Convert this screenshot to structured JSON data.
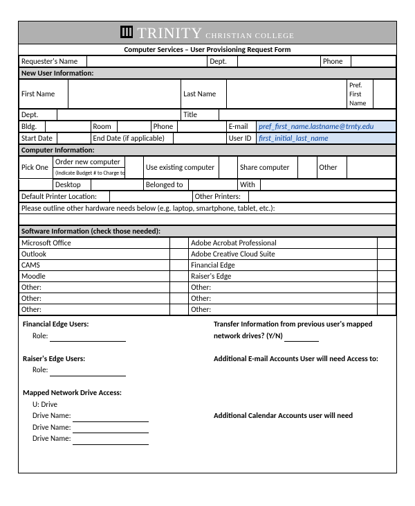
{
  "brand": {
    "main": "TRINITY",
    "sub": "CHRISTIAN COLLEGE"
  },
  "form_title": "Computer Services – User Provisioning Request Form",
  "requester": {
    "name_label": "Requester's Name",
    "dept_label": "Dept.",
    "phone_label": "Phone"
  },
  "sections": {
    "new_user": "New User Information:",
    "computer": "Computer Information:",
    "software": "Software Information (check those needed):"
  },
  "new_user": {
    "first_name": "First Name",
    "last_name": "Last Name",
    "pref_first": "Pref. First Name",
    "dept": "Dept.",
    "title": "Title",
    "bldg": "Bldg.",
    "room": "Room",
    "phone": "Phone",
    "email": "E-mail",
    "email_hint": "pref_first_name.lastname@trnty.edu",
    "start_date": "Start Date",
    "end_date": "End Date (if applicable)",
    "user_id": "User ID",
    "user_id_hint": "first_initial_last_name"
  },
  "computer": {
    "pick_one": "Pick One",
    "order_new": "Order new computer",
    "order_hint": "(Indicate Budget # to Charge to)",
    "use_existing": "Use existing computer",
    "share": "Share computer",
    "other": "Other",
    "desktop": "Desktop",
    "belonged_to": "Belonged to",
    "with": "With",
    "default_printer": "Default Printer Location:",
    "other_printers": "Other Printers:",
    "outline": "Please outline other hardware needs below (e.g. laptop, smartphone, tablet, etc.):"
  },
  "software": {
    "left": [
      "Microsoft Office",
      "Outlook",
      "CAMS",
      "Moodle",
      "Other:",
      "Other:",
      "Other:"
    ],
    "right": [
      "Adobe Acrobat Professional",
      "Adobe Creative Cloud Suite",
      "Financial Edge",
      "Raiser's Edge",
      "Other:",
      "Other:",
      "Other:"
    ]
  },
  "bottom": {
    "fe_users": "Financial Edge Users:",
    "re_users": "Raiser's Edge Users:",
    "role": "Role:",
    "mapped": "Mapped Network Drive Access:",
    "u_drive": "U: Drive",
    "drive_name": "Drive Name:",
    "transfer": "Transfer Information from previous user's mapped network drives? (Y/N)",
    "add_email": "Additional E-mail Accounts User will need Access to:",
    "add_cal": "Additional Calendar Accounts user will need"
  }
}
